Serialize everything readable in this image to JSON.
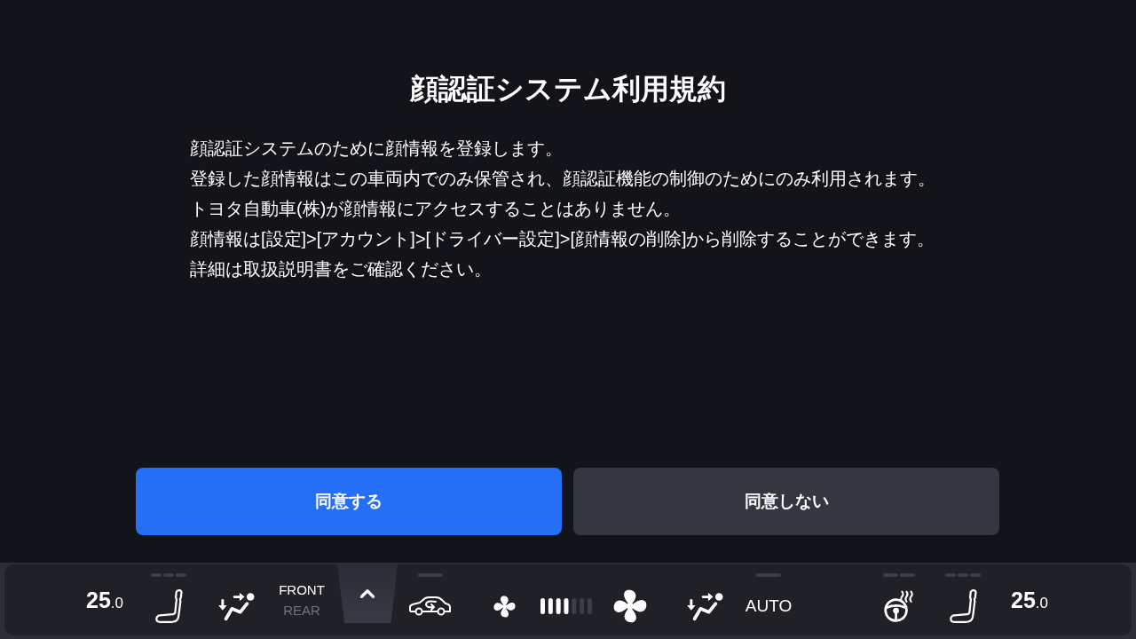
{
  "dialog": {
    "title": "顔認証システム利用規約",
    "lines": [
      "顔認証システムのために顔情報を登録します。",
      "登録した顔情報はこの車両内でのみ保管され、顔認証機能の制御のためにのみ利用されます。",
      "トヨタ自動車(株)が顔情報にアクセスすることはありません。",
      "顔情報は[設定]>[アカウント]>[ドライバー設定]>[顔情報の削除]から削除することができます。",
      "詳細は取扱説明書をご確認ください。"
    ]
  },
  "buttons": [
    {
      "label": "同意する",
      "kind": "primary"
    },
    {
      "label": "同意しない",
      "kind": "secondary"
    }
  ],
  "climate_bar": {
    "items": [
      {
        "kind": "temperature",
        "whole": "25",
        "fraction": ".0"
      },
      {
        "kind": "seat-heater",
        "segments": [
          {
            "on": false
          },
          {
            "on": false
          },
          {
            "on": false
          }
        ]
      },
      {
        "kind": "airflow"
      },
      {
        "kind": "zone",
        "options": [
          {
            "label": "FRONT",
            "selected": true
          },
          {
            "label": "REAR",
            "selected": false
          }
        ]
      },
      {
        "kind": "expand"
      },
      {
        "kind": "recirculation",
        "on": false
      },
      {
        "kind": "fan-low"
      },
      {
        "kind": "fan-speed",
        "level": 0.5714
      },
      {
        "kind": "fan-high"
      },
      {
        "kind": "airflow"
      },
      {
        "kind": "auto",
        "label": "AUTO",
        "on": false
      },
      {
        "kind": "steering-heater",
        "segments": [
          {
            "on": false
          },
          {
            "on": false
          }
        ]
      },
      {
        "kind": "seat-heater",
        "segments": [
          {
            "on": false
          },
          {
            "on": false
          },
          {
            "on": false
          }
        ]
      },
      {
        "kind": "temperature",
        "whole": "25",
        "fraction": ".0"
      }
    ]
  }
}
